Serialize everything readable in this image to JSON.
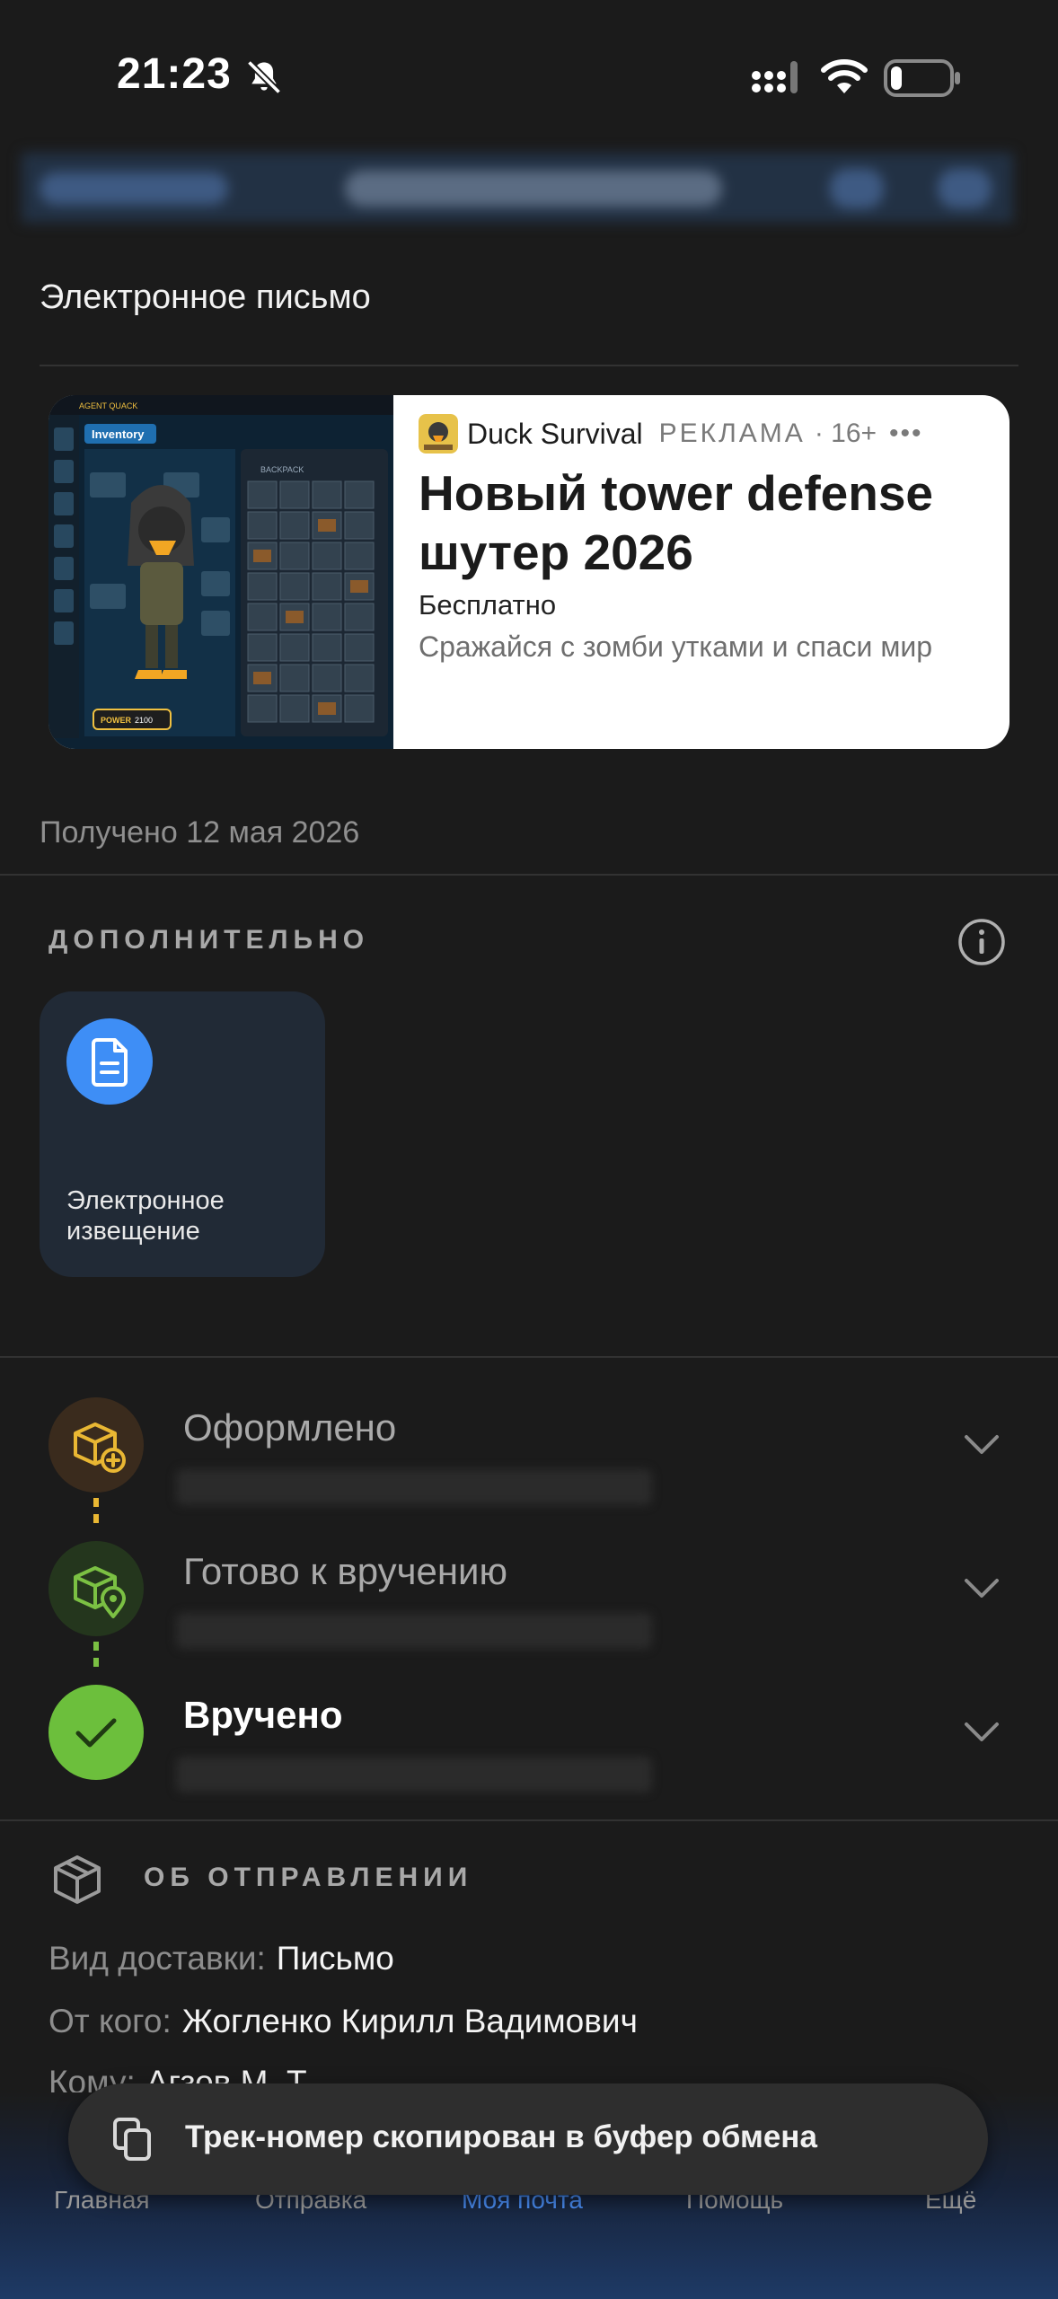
{
  "status_bar": {
    "time": "21:23"
  },
  "message": {
    "subject": "Электронное  письмо",
    "received": "Получено 12 мая 2026"
  },
  "ad": {
    "app_name": "Duck Survival",
    "label": "РЕКЛАМА",
    "age": "· 16+",
    "more": "•••",
    "title": "Новый tower defense шутер 2026",
    "price": "Бесплатно",
    "description": "Сражайся с зомби утками и спаси мир",
    "image_texts": {
      "character": "AGENT QUACK",
      "inventory": "Inventory",
      "backpack": "BACKPACK",
      "power": "POWER",
      "power_value": "2100"
    }
  },
  "extra": {
    "heading": "ДОПОЛНИТЕЛЬНО",
    "tile_label": "Электронное извещение"
  },
  "tracking": {
    "steps": [
      {
        "title": "Оформлено",
        "color": "#e9b733",
        "bg": "#3a2b1d"
      },
      {
        "title": "Готово к вручению",
        "color": "#7bc043",
        "bg": "#24361d"
      },
      {
        "title": "Вручено",
        "color": "#ffffff",
        "bg": "#6cbf3c"
      }
    ]
  },
  "shipment": {
    "heading": "ОБ ОТПРАВЛЕНИИ",
    "rows": [
      {
        "label": "Вид доставки:",
        "value": "Письмо"
      },
      {
        "label": "От кого:",
        "value": "Жогленко Кирилл Вадимович"
      },
      {
        "label": "Кому:",
        "value": "Агзов М. Т."
      }
    ]
  },
  "bottom_nav": {
    "items": [
      "Главная",
      "Отправка",
      "Моя почта",
      "Помощь",
      "Ещё"
    ],
    "active_index": 2
  },
  "toast": {
    "text": "Трек-номер скопирован в буфер обмена"
  },
  "colors": {
    "background": "#1b1b1b",
    "accent": "#4a8ef5",
    "tile": "#212a36"
  }
}
